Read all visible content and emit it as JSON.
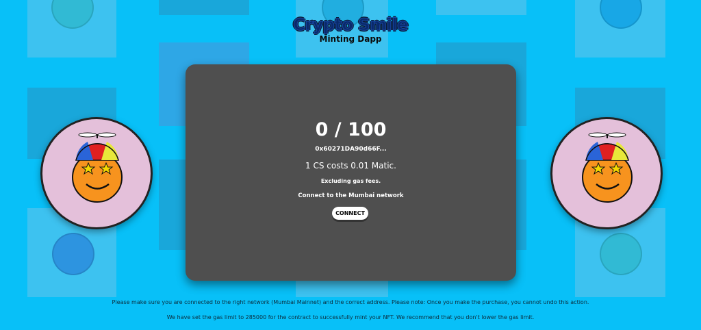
{
  "header": {
    "title": "Crypto Smile",
    "subtitle": "Minting Dapp"
  },
  "mint_card": {
    "supply": "0 / 100",
    "contract_address": "0x60271DA90d66F...",
    "price": "1 CS costs 0.01 Matic.",
    "gas_note": "Excluding gas fees.",
    "network_prompt": "Connect to the Mumbai network",
    "connect_label": "CONNECT"
  },
  "footer": {
    "notice": "Please make sure you are connected to the right network (Mumbai Mainnet) and the correct address. Please note: Once you make the purchase, you cannot undo this action.",
    "gas_limit": "We have set the gas limit to 285000 for the contract to successfully mint your NFT. We recommend that you don't lower the gas limit."
  },
  "colors": {
    "background": "#08c0f8",
    "card": "#4f4f4f",
    "avatar_bg": "#e4c0da",
    "smiley": "#f7931e"
  },
  "icons": {
    "left_avatar": "propeller-hat-smiley-icon",
    "right_avatar": "propeller-hat-smiley-icon"
  }
}
